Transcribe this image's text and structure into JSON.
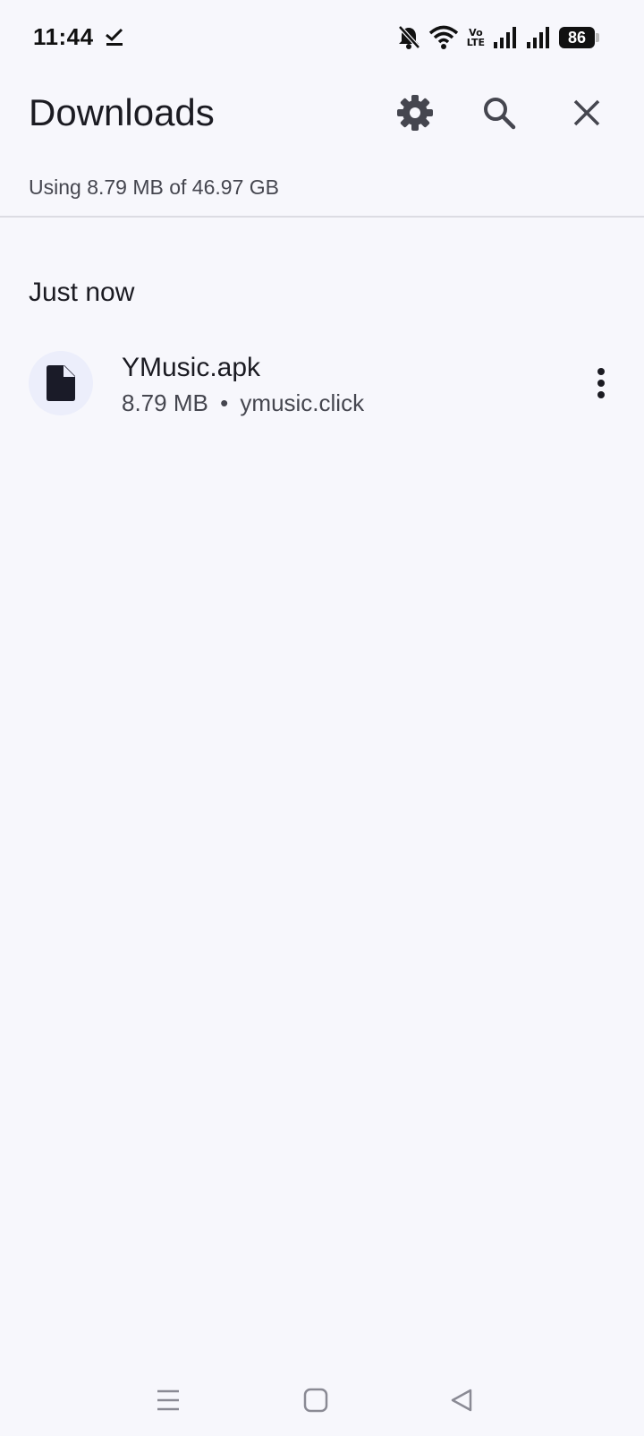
{
  "status_bar": {
    "time": "11:44",
    "volte_top": "Vo",
    "volte_bottom": "LTE",
    "battery_level": "86",
    "icons": [
      "check-icon",
      "bell-off-icon",
      "wifi-icon",
      "volte-icon",
      "signal-icon",
      "signal-icon",
      "battery-icon"
    ]
  },
  "app_bar": {
    "title": "Downloads",
    "actions": [
      "settings-icon",
      "search-icon",
      "close-icon"
    ]
  },
  "storage": {
    "text": "Using 8.79 MB of 46.97 GB"
  },
  "sections": [
    {
      "header": "Just now",
      "items": [
        {
          "name": "YMusic.apk",
          "size": "8.79 MB",
          "separator": "•",
          "source": "ymusic.click",
          "icon": "file-icon"
        }
      ]
    }
  ],
  "nav_bar": {
    "buttons": [
      "menu-icon",
      "home-icon",
      "back-icon"
    ]
  },
  "colors": {
    "background": "#f7f7fc",
    "icon_dark": "#45464f",
    "file_icon_bg": "#eceefb"
  }
}
